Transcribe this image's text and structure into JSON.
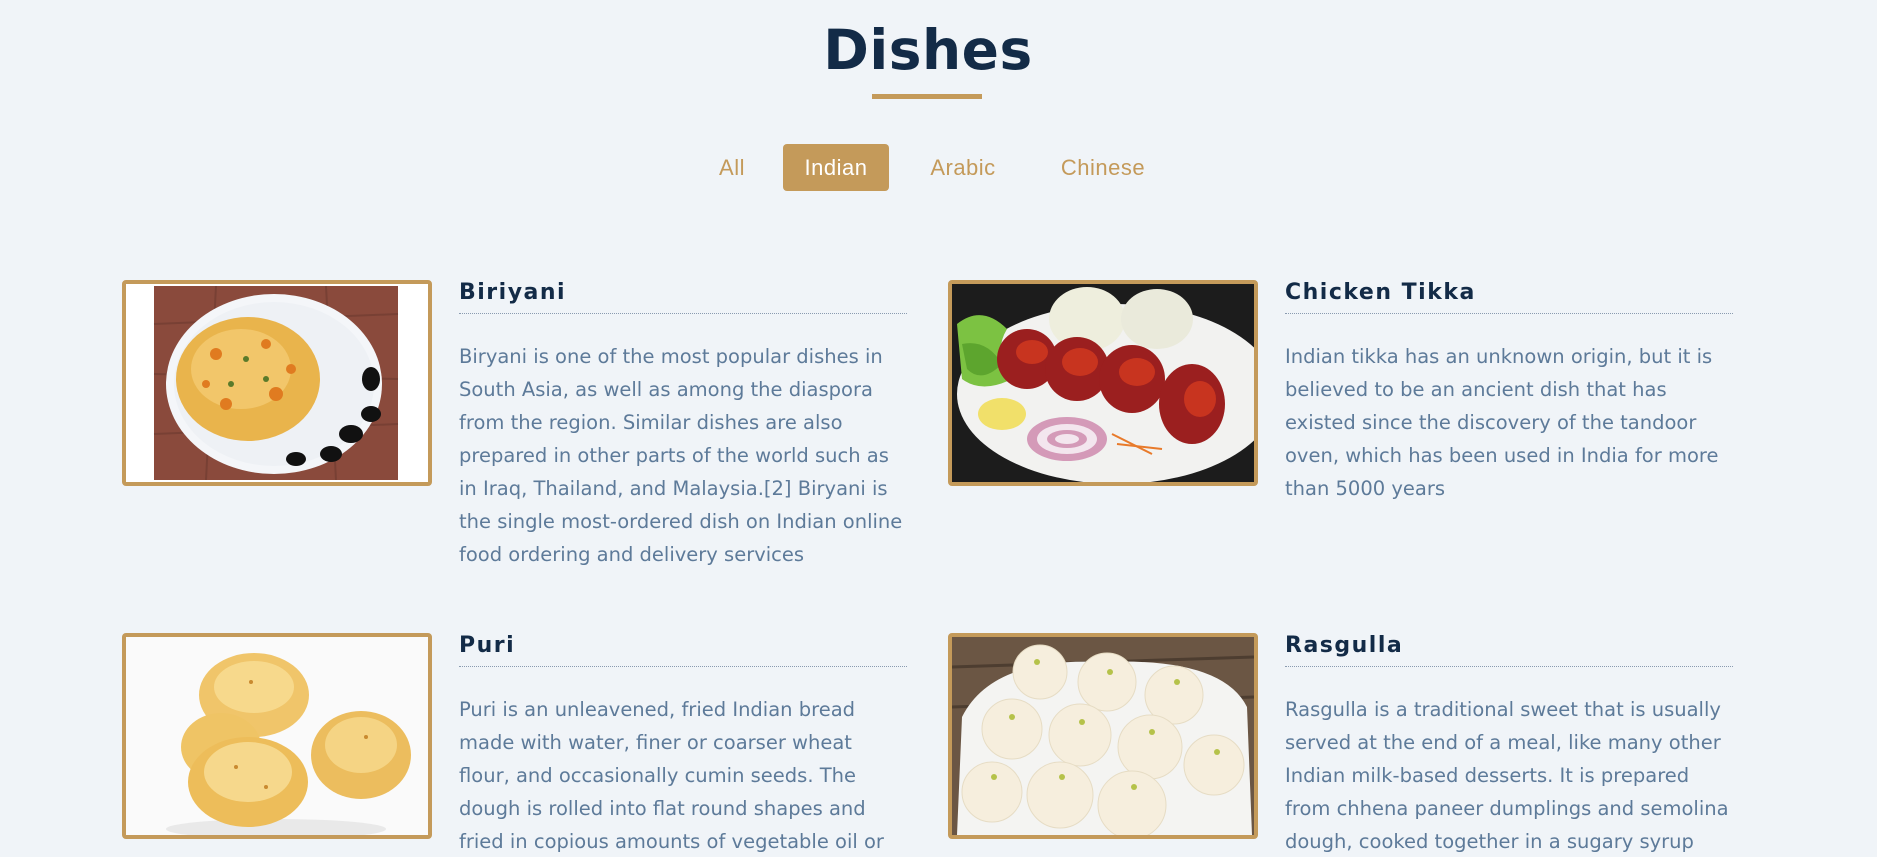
{
  "section": {
    "title": "Dishes"
  },
  "filters": [
    {
      "label": "All",
      "active": false
    },
    {
      "label": "Indian",
      "active": true
    },
    {
      "label": "Arabic",
      "active": false
    },
    {
      "label": "Chinese",
      "active": false
    }
  ],
  "colors": {
    "accent": "#c49a5a",
    "heading": "#132b47",
    "body_text": "#5d7a99",
    "background": "#f0f4f8"
  },
  "dishes": [
    {
      "name": "Biriyani",
      "description": "Biryani is one of the most popular dishes in South Asia, as well as among the diaspora from the region. Similar dishes are also prepared in other parts of the world such as in Iraq, Thailand, and Malaysia.[2] Biryani is the single most-ordered dish on Indian online food ordering and delivery services",
      "image": "biriyani-plate-image"
    },
    {
      "name": "Chicken Tikka",
      "description": "Indian tikka has an unknown origin, but it is believed to be an ancient dish that has existed since the discovery of the tandoor oven, which has been used in India for more than 5000 years",
      "image": "chicken-tikka-image"
    },
    {
      "name": "Puri",
      "description": "Puri is an unleavened, fried Indian bread made with water, finer or coarser wheat flour, and occasionally cumin seeds. The dough is rolled into flat round shapes and fried in copious amounts of vegetable oil or ghee.",
      "image": "puri-bread-image"
    },
    {
      "name": "Rasgulla",
      "description": "Rasgulla is a traditional sweet that is usually served at the end of a meal, like many other Indian milk-based desserts. It is prepared from chhena paneer dumplings and semolina dough, cooked together in a sugary syrup",
      "image": "rasgulla-sweets-image"
    }
  ]
}
